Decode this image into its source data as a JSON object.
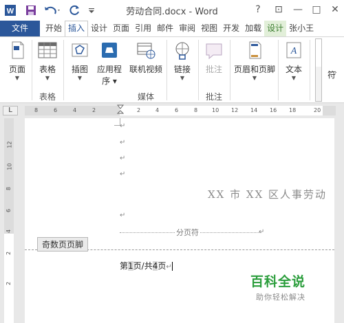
{
  "window": {
    "title": "劳动合同.docx - Word",
    "help": "?",
    "restore_ribbon": "⊡",
    "minimize": "—",
    "maximize": "□",
    "close": "✕"
  },
  "tabs": [
    {
      "label": "文件"
    },
    {
      "label": "开始"
    },
    {
      "label": "插入"
    },
    {
      "label": "设计"
    },
    {
      "label": "页面"
    },
    {
      "label": "引用"
    },
    {
      "label": "邮件"
    },
    {
      "label": "审阅"
    },
    {
      "label": "视图"
    },
    {
      "label": "开发"
    },
    {
      "label": "加载"
    },
    {
      "label": "设计"
    },
    {
      "label": "张小王"
    }
  ],
  "ribbon": {
    "pages": "页面",
    "table": "表格",
    "illustrations": "插图",
    "apps": "应用程",
    "apps2": "序",
    "online_video": "联机视频",
    "link": "链接",
    "comment": "批注",
    "header_footer": "页眉和页脚",
    "text": "文本",
    "symbols": "符",
    "groups": {
      "table": "表格",
      "media": "媒体",
      "comments": "批注"
    }
  },
  "ruler": {
    "corner": "L",
    "h_numbers": [
      "8",
      "6",
      "4",
      "2",
      "2",
      "4",
      "6",
      "8",
      "10",
      "12",
      "14",
      "16",
      "18",
      "20"
    ],
    "v_numbers": [
      "12",
      "10",
      "8",
      "6",
      "4",
      "2",
      "2"
    ]
  },
  "document": {
    "heading": "XX 市 XX 区人事劳动",
    "page_break": "分页符",
    "footer_tag": "奇数页页脚",
    "footer_text": {
      "p1": "第",
      "n1": "1",
      "p2": "页/共",
      "n2": "4",
      "p3": "页"
    },
    "paragraph_mark": "↵"
  },
  "watermark": {
    "title": "百科全说",
    "subtitle": "助你轻松解决"
  },
  "colors": {
    "accent": "#2b579a",
    "context_tab": "#e2efd9",
    "watermark_green": "#2a9d3b"
  }
}
